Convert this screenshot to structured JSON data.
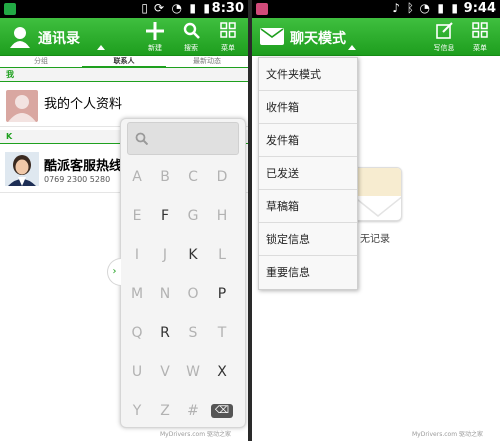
{
  "left": {
    "status": {
      "time": "8:30"
    },
    "actionbar": {
      "title": "通讯录",
      "new_label": "新建",
      "search_label": "搜索",
      "menu_label": "菜单"
    },
    "tabs": [
      "分组",
      "联系人",
      "最新动态"
    ],
    "sections": [
      {
        "header": "我",
        "contact_name": "我的个人资料"
      },
      {
        "header": "K",
        "contact_name": "酷派客服热线",
        "contact_phone": "0769 2300 5280"
      }
    ],
    "indexer": {
      "keys": [
        [
          "A",
          "B",
          "C",
          "D"
        ],
        [
          "E",
          "F",
          "G",
          "H"
        ],
        [
          "I",
          "J",
          "K",
          "L"
        ],
        [
          "M",
          "N",
          "O",
          "P"
        ],
        [
          "Q",
          "R",
          "S",
          "T"
        ],
        [
          "U",
          "V",
          "W",
          "X"
        ],
        [
          "Y",
          "Z",
          "#",
          "⌫"
        ]
      ],
      "enabled": [
        "F",
        "K",
        "P",
        "R",
        "X",
        "⌫"
      ]
    },
    "watermark": "MyDrivers.com 驱动之家"
  },
  "right": {
    "status": {
      "time": "9:44"
    },
    "actionbar": {
      "title": "聊天模式",
      "compose_label": "写信息",
      "menu_label": "菜单"
    },
    "dropdown": [
      "文件夹模式",
      "收件箱",
      "发件箱",
      "已发送",
      "草稿箱",
      "锁定信息",
      "重要信息"
    ],
    "empty_label": "无记录",
    "watermark": "MyDrivers.com 驱动之家"
  },
  "colors": {
    "accent": "#1ea01e",
    "statusbar": "#000000"
  }
}
